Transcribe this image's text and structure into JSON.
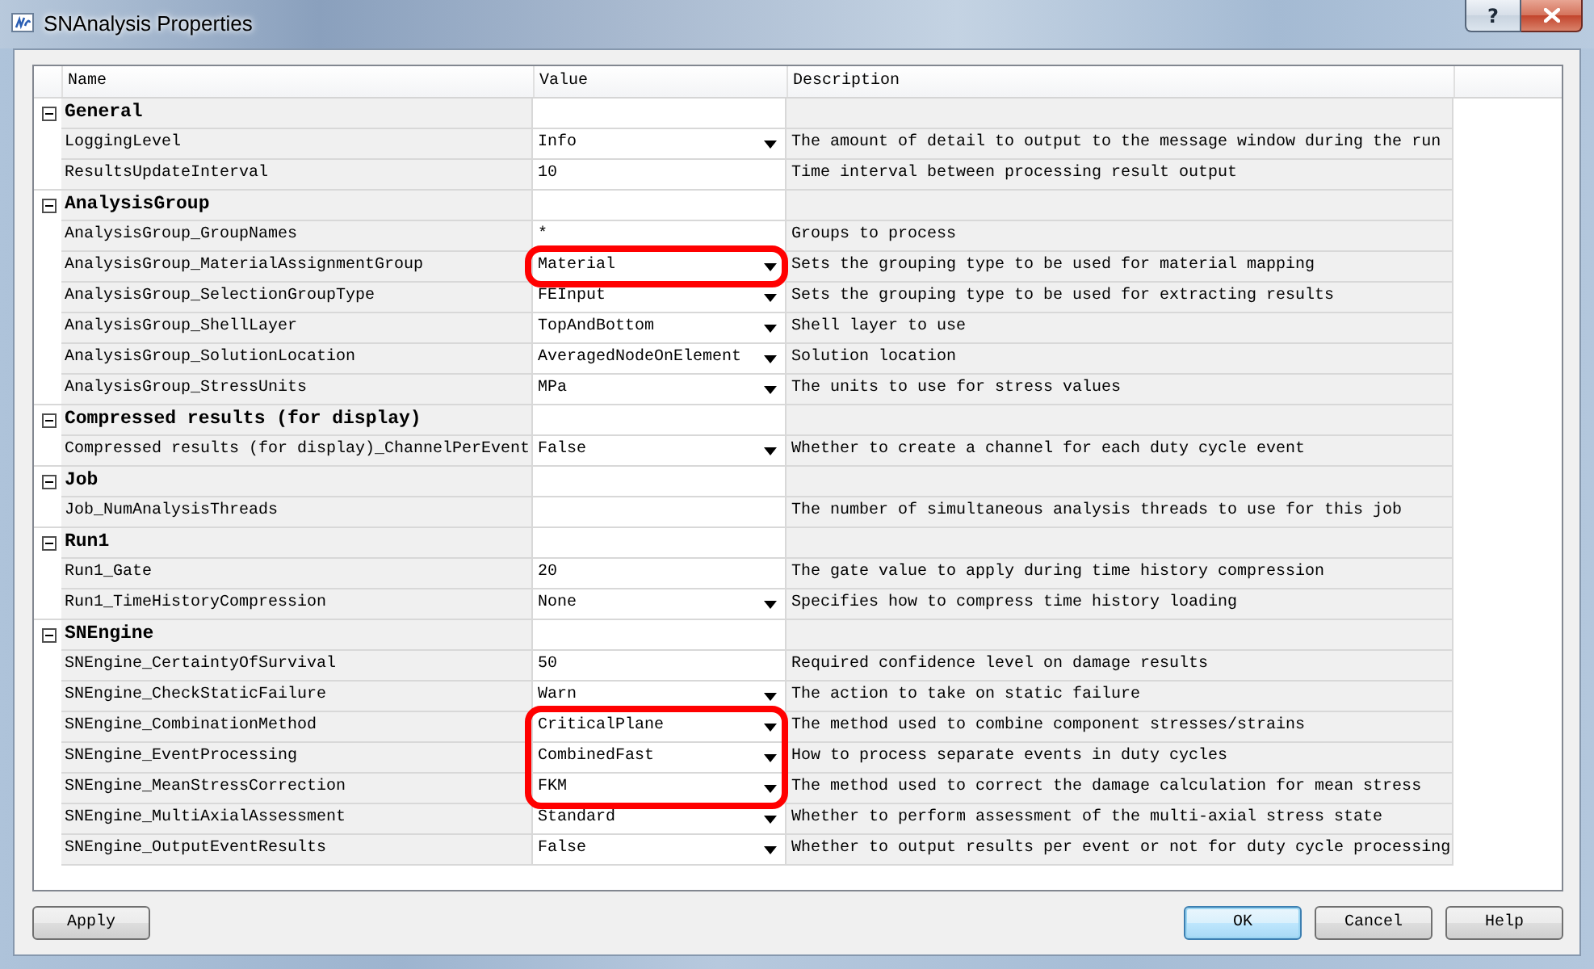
{
  "window": {
    "title": "SNAnalysis Properties",
    "help_button": "?"
  },
  "grid": {
    "columns": [
      "Name",
      "Value",
      "Description"
    ],
    "categories": [
      {
        "name": "General",
        "expanded": true,
        "properties": [
          {
            "name": "LoggingLevel",
            "kind": "dropdown",
            "value": "Info",
            "description": "The amount of detail to output to the message window during the run",
            "highlighted": false
          },
          {
            "name": "ResultsUpdateInterval",
            "kind": "text",
            "value": "10",
            "description": "Time interval between processing result output",
            "highlighted": false
          }
        ]
      },
      {
        "name": "AnalysisGroup",
        "expanded": true,
        "properties": [
          {
            "name": "AnalysisGroup_GroupNames",
            "kind": "text",
            "value": "*",
            "description": "Groups to process",
            "highlighted": false
          },
          {
            "name": "AnalysisGroup_MaterialAssignmentGroup",
            "kind": "dropdown",
            "value": "Material",
            "description": "Sets the grouping type to be used for material mapping",
            "highlighted": true
          },
          {
            "name": "AnalysisGroup_SelectionGroupType",
            "kind": "dropdown",
            "value": "FEInput",
            "description": "Sets the grouping type to be used for extracting results",
            "highlighted": false
          },
          {
            "name": "AnalysisGroup_ShellLayer",
            "kind": "dropdown",
            "value": "TopAndBottom",
            "description": "Shell layer to use",
            "highlighted": false
          },
          {
            "name": "AnalysisGroup_SolutionLocation",
            "kind": "dropdown",
            "value": "AveragedNodeOnElement",
            "description": "Solution location",
            "highlighted": false
          },
          {
            "name": "AnalysisGroup_StressUnits",
            "kind": "dropdown",
            "value": "MPa",
            "description": "The units to use for stress values",
            "highlighted": false
          }
        ]
      },
      {
        "name": "Compressed results (for display)",
        "expanded": true,
        "properties": [
          {
            "name": "Compressed results (for display)_ChannelPerEvent",
            "kind": "dropdown",
            "value": "False",
            "description": "Whether to create a channel for each duty cycle event",
            "highlighted": false
          }
        ]
      },
      {
        "name": "Job",
        "expanded": true,
        "properties": [
          {
            "name": "Job_NumAnalysisThreads",
            "kind": "text",
            "description": "The number of simultaneous analysis threads to use for this job",
            "highlighted": false
          }
        ]
      },
      {
        "name": "Run1",
        "expanded": true,
        "properties": [
          {
            "name": "Run1_Gate",
            "kind": "text",
            "value": "20",
            "description": "The gate value to apply during time history compression",
            "highlighted": false
          },
          {
            "name": "Run1_TimeHistoryCompression",
            "kind": "dropdown",
            "value": "None",
            "description": "Specifies how to compress time history loading",
            "highlighted": false
          }
        ]
      },
      {
        "name": "SNEngine",
        "expanded": true,
        "properties": [
          {
            "name": "SNEngine_CertaintyOfSurvival",
            "kind": "text",
            "value": "50",
            "description": "Required confidence level on damage results",
            "highlighted": false
          },
          {
            "name": "SNEngine_CheckStaticFailure",
            "kind": "dropdown",
            "value": "Warn",
            "description": "The action to take on static failure",
            "highlighted": false
          },
          {
            "name": "SNEngine_CombinationMethod",
            "kind": "dropdown",
            "value": "CriticalPlane",
            "description": "The method used to combine component stresses/strains",
            "highlighted": true
          },
          {
            "name": "SNEngine_EventProcessing",
            "kind": "dropdown",
            "value": "CombinedFast",
            "description": "How to process separate events in duty cycles",
            "highlighted": true
          },
          {
            "name": "SNEngine_MeanStressCorrection",
            "kind": "dropdown",
            "value": "FKM",
            "description": "The method used to correct the damage calculation for mean stress",
            "highlighted": true
          },
          {
            "name": "SNEngine_MultiAxialAssessment",
            "kind": "dropdown",
            "value": "Standard",
            "description": "Whether to perform assessment of the multi-axial stress state",
            "highlighted": false
          },
          {
            "name": "SNEngine_OutputEventResults",
            "kind": "dropdown",
            "value": "False",
            "description": "Whether to output results per event or not for duty cycle processing",
            "highlighted": false
          }
        ]
      }
    ]
  },
  "buttons": {
    "left": [
      {
        "label": "Apply",
        "default": false
      }
    ],
    "right": [
      {
        "label": "OK",
        "default": true
      },
      {
        "label": "Cancel",
        "default": false
      },
      {
        "label": "Help",
        "default": false
      }
    ]
  }
}
